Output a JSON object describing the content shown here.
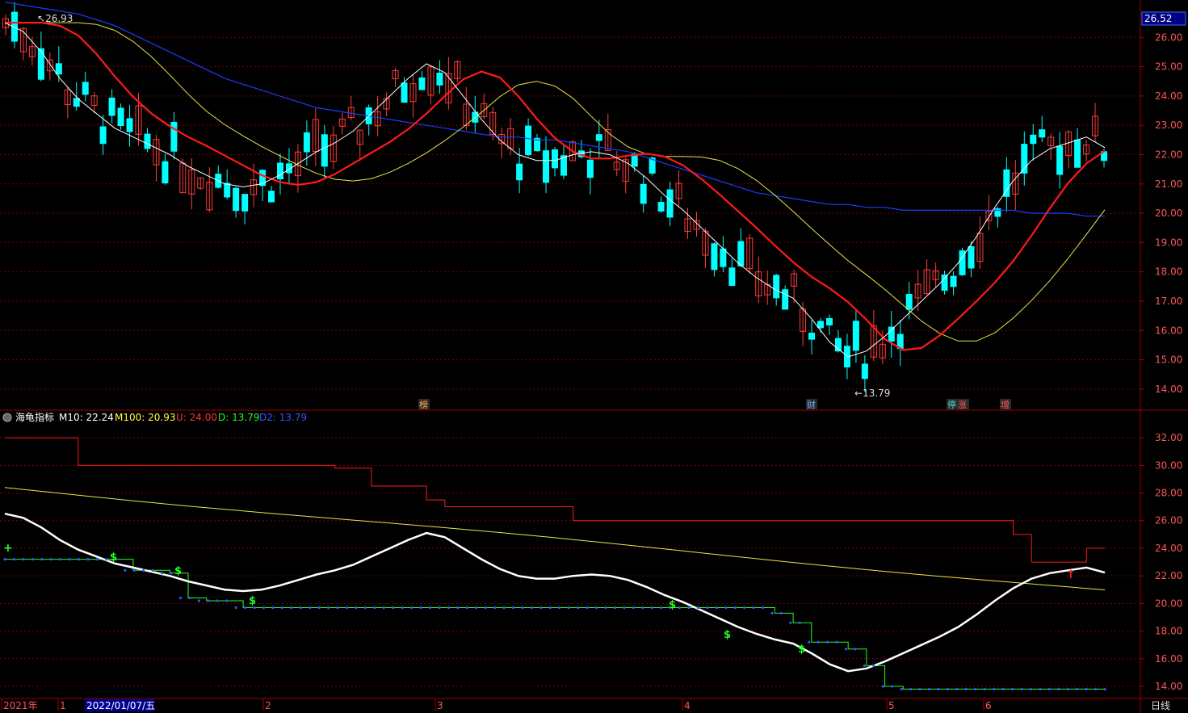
{
  "upper_panel": {
    "y_ticks": [
      "26.00",
      "25.00",
      "24.00",
      "23.00",
      "22.00",
      "21.00",
      "20.00",
      "19.00",
      "18.00",
      "17.00",
      "16.00",
      "15.00",
      "14.00"
    ],
    "current_price_label": "26.52",
    "high_marker": "26.93",
    "low_marker": "13.79",
    "event_markers": [
      {
        "text": "榜",
        "color": "#ffb14a"
      },
      {
        "text": "财",
        "color": "#6ab0ff"
      },
      {
        "text": "停",
        "color": "#40e0d0"
      },
      {
        "text": "涨",
        "color": "#ff5a5a"
      },
      {
        "text": "增",
        "color": "#ff5a5a"
      }
    ]
  },
  "indicator": {
    "name": "海龟指标",
    "values": [
      {
        "label": "M10: 22.24",
        "color": "#ffffff"
      },
      {
        "label": "M100: 20.93",
        "color": "#ffff40"
      },
      {
        "label": "U: 24.00",
        "color": "#ff3030"
      },
      {
        "label": "D: 13.79",
        "color": "#20ff20"
      },
      {
        "label": "D2: 13.79",
        "color": "#3355ff"
      }
    ],
    "y_ticks": [
      "32.00",
      "30.00",
      "28.00",
      "26.00",
      "24.00",
      "22.00",
      "20.00",
      "18.00",
      "16.00",
      "14.00"
    ]
  },
  "x_axis": {
    "labels": [
      "2021年",
      "1",
      "2022/01/07/五",
      "2",
      "3",
      "4",
      "5",
      "6"
    ],
    "period": "日线"
  },
  "colors": {
    "up": "#ff3b3b",
    "down": "#00ffff",
    "ma_fast": "#ffffff",
    "ma_red": "#ff1a1a",
    "ma_yellow": "#e6e64a",
    "ma_blue": "#1a3dff",
    "grid": "#8b0000",
    "axis_text": "#ff5555"
  },
  "chart_data": [
    {
      "type": "line",
      "panel": "price",
      "ylim": [
        13.5,
        27.0
      ],
      "series": [
        {
          "name": "M10",
          "values": [
            26.5,
            26.2,
            25.5,
            24.6,
            23.9,
            23.4,
            22.9,
            22.6,
            22.3,
            22.0,
            21.6,
            21.3,
            21.0,
            20.9,
            21.0,
            21.3,
            21.7,
            22.1,
            22.4,
            22.8,
            23.4,
            24.0,
            24.6,
            25.1,
            24.8,
            24.0,
            23.2,
            22.5,
            22.0,
            21.8,
            21.8,
            22.0,
            22.1,
            22.0,
            21.7,
            21.2,
            20.6,
            20.1,
            19.5,
            18.9,
            18.3,
            17.8,
            17.4,
            17.1,
            16.4,
            15.6,
            15.1,
            15.3,
            15.8,
            16.4,
            17.0,
            17.6,
            18.3,
            19.2,
            20.2,
            21.1,
            21.8,
            22.2,
            22.4,
            22.6,
            22.24
          ]
        },
        {
          "name": "M100",
          "values": [
            26.9,
            26.8,
            26.7,
            26.6,
            26.5,
            26.3,
            26.1,
            25.8,
            25.5,
            25.2,
            24.9,
            24.6,
            24.3,
            24.1,
            23.9,
            23.7,
            23.5,
            23.3,
            23.2,
            23.1,
            23.0,
            22.9,
            22.8,
            22.7,
            22.6,
            22.5,
            22.4,
            22.3,
            22.3,
            22.2,
            22.2,
            22.1,
            22.0,
            21.9,
            21.8,
            21.6,
            21.4,
            21.2,
            21.0,
            20.8,
            20.6,
            20.4,
            20.3,
            20.2,
            20.1,
            20.0,
            20.0,
            19.9,
            19.9,
            19.8,
            19.8,
            19.8,
            19.8,
            19.8,
            19.8,
            19.8,
            19.7,
            19.7,
            19.7,
            19.6,
            19.6
          ]
        },
        {
          "name": "U",
          "values": [
            32.0,
            32.0,
            32.0,
            32.0,
            30.0,
            30.0,
            30.0,
            30.0,
            30.0,
            30.0,
            30.0,
            30.0,
            30.0,
            30.0,
            30.0,
            30.0,
            30.0,
            30.0,
            29.8,
            29.8,
            28.5,
            28.5,
            28.5,
            27.5,
            27.0,
            27.0,
            27.0,
            27.0,
            27.0,
            27.0,
            27.0,
            26.0,
            26.0,
            26.0,
            26.0,
            26.0,
            26.0,
            26.0,
            26.0,
            26.0,
            26.0,
            26.0,
            26.0,
            26.0,
            26.0,
            26.0,
            26.0,
            26.0,
            26.0,
            26.0,
            26.0,
            26.0,
            26.0,
            26.0,
            26.0,
            25.0,
            23.0,
            23.0,
            23.0,
            24.0,
            24.0
          ]
        },
        {
          "name": "D",
          "values": [
            23.2,
            23.2,
            23.2,
            23.2,
            23.2,
            23.2,
            23.2,
            22.4,
            22.4,
            22.2,
            20.4,
            20.2,
            20.2,
            19.7,
            19.7,
            19.7,
            19.7,
            19.7,
            19.7,
            19.7,
            19.7,
            19.7,
            19.7,
            19.7,
            19.7,
            19.7,
            19.7,
            19.7,
            19.7,
            19.7,
            19.7,
            19.7,
            19.7,
            19.7,
            19.7,
            19.7,
            19.7,
            19.7,
            19.7,
            19.7,
            19.7,
            19.7,
            19.3,
            18.6,
            17.2,
            17.2,
            16.7,
            15.5,
            14.0,
            13.8,
            13.8,
            13.8,
            13.8,
            13.8,
            13.8,
            13.8,
            13.8,
            13.8,
            13.8,
            13.8,
            13.79
          ]
        }
      ]
    }
  ]
}
